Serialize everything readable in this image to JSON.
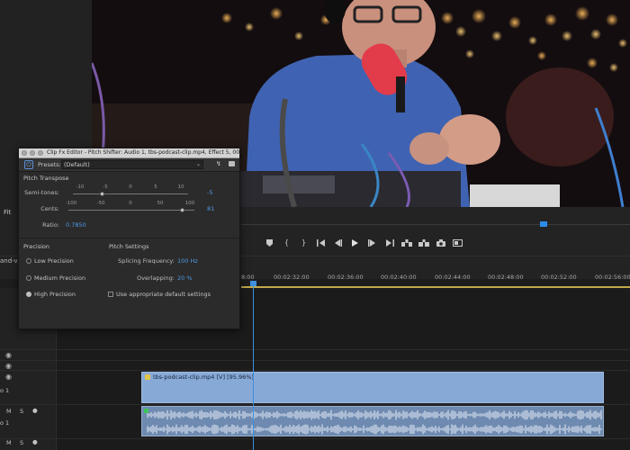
{
  "monitor": {
    "fit_label": "Fit"
  },
  "transport": {
    "buttons": [
      "marker",
      "in-point",
      "out-point",
      "go-to-in",
      "step-back",
      "play",
      "step-forward",
      "go-to-out",
      "lift",
      "extract",
      "export-frame",
      "button-editor"
    ]
  },
  "timeline": {
    "panel_label": "and-vis",
    "timecodes": [
      "8:00",
      "00:02:32:00",
      "00:02:36:00",
      "00:02:40:00",
      "00:02:44:00",
      "00:02:48:00",
      "00:02:52:00",
      "00:02:56:00"
    ],
    "video_clip_label": "tbs-podcast-clip.mp4 [V] [95.96%]",
    "track_labels": {
      "v1": "o 1",
      "a1": "o 1",
      "m": "M",
      "s": "S"
    }
  },
  "fx_editor": {
    "title": "Clip Fx Editor - Pitch Shifter: Audio 1, tbs-podcast-clip.mp4, Effect 5, 00:...",
    "presets_label": "Presets:",
    "preset_value": "(Default)",
    "pitch_transpose_title": "Pitch Transpose",
    "semitones": {
      "label": "Semi-tones:",
      "value": "-5",
      "scale": [
        "-10",
        "-5",
        "0",
        "5",
        "10"
      ],
      "position": 0.25
    },
    "cents": {
      "label": "Cents:",
      "value": "81",
      "scale": [
        "-100",
        "-50",
        "0",
        "50",
        "100"
      ],
      "position": 0.905
    },
    "ratio": {
      "label": "Ratio:",
      "value": "0.7850"
    },
    "precision": {
      "title": "Precision",
      "options": [
        "Low Precision",
        "Medium Precision",
        "High Precision"
      ],
      "selected": "High Precision"
    },
    "pitch_settings": {
      "title": "Pitch Settings",
      "splicing_label": "Splicing Frequency:",
      "splicing_value": "100 Hz",
      "overlapping_label": "Overlapping:",
      "overlapping_value": "20 %",
      "checkbox_label": "Use appropriate default settings"
    }
  },
  "colors": {
    "accent_blue": "#4f9be8",
    "video_clip": "#87a9d6",
    "audio_clip": "#6e8ab0",
    "work_area": "#c3a84a"
  }
}
